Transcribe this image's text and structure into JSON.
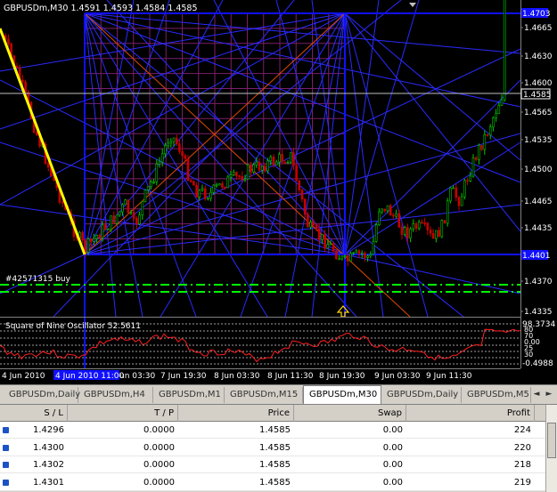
{
  "window": {
    "symbol_info": "GBPUSDm,M30  1.4591 1.4593 1.4584 1.4585",
    "top_right_price": "1.4703",
    "current_price": "1.4585",
    "level_price": "1.4401",
    "order_label": "#42571315 buy",
    "oscillator_label": "Square of Nine Oscillator 52.5611",
    "oscillator_top": "98.3734",
    "oscillator_bottom": "-0.4988",
    "oscillator_levels": [
      "80",
      "70",
      "0.00",
      "25",
      "30"
    ],
    "highlighted_date": "4 Jun 2010 11:00"
  },
  "price_axis": [
    "1.4665",
    "1.4630",
    "1.4600",
    "1.4565",
    "1.4535",
    "1.4500",
    "1.4465",
    "1.4435",
    "1.4370",
    "1.4335"
  ],
  "time_axis": [
    "4 Jun 2010",
    "un 03:30",
    "7 Jun 19:30",
    "8 Jun 03:30",
    "8 Jun 11:30",
    "8 Jun 19:30",
    "9 Jun 03:30",
    "9 Jun 11:30"
  ],
  "tabs": [
    "GBPUSDm,Daily",
    "GBPUSDm,H4",
    "GBPUSDm,M1",
    "GBPUSDm,M15",
    "GBPUSDm,M30",
    "GBPUSDm,Daily",
    "GBPUSDm,M5"
  ],
  "active_tab": "GBPUSDm,M30",
  "table": {
    "headers": [
      "S / L",
      "T / P",
      "Price",
      "Swap",
      "Profit"
    ],
    "rows": [
      [
        "1.4296",
        "0.0000",
        "1.4585",
        "0.00",
        "224"
      ],
      [
        "1.4300",
        "0.0000",
        "1.4585",
        "0.00",
        "220"
      ],
      [
        "1.4302",
        "0.0000",
        "1.4585",
        "0.00",
        "218"
      ],
      [
        "1.4301",
        "0.0000",
        "1.4585",
        "0.00",
        "219"
      ]
    ]
  },
  "colors": {
    "background": "#000000",
    "grid_blue": "#2a2aff",
    "grid_purple": "#7a1f6a",
    "bull_candle": "#00c800",
    "bear_candle": "#c80000",
    "trend_yellow": "#ffff00",
    "order_green": "#00ff00",
    "osc_red": "#ff2020",
    "axis_text": "#ffffff"
  },
  "icons": [
    "dropdown-arrow-icon",
    "up-arrow-marker-icon",
    "tab-left-arrow-icon",
    "tab-right-arrow-icon",
    "row-order-icon"
  ]
}
